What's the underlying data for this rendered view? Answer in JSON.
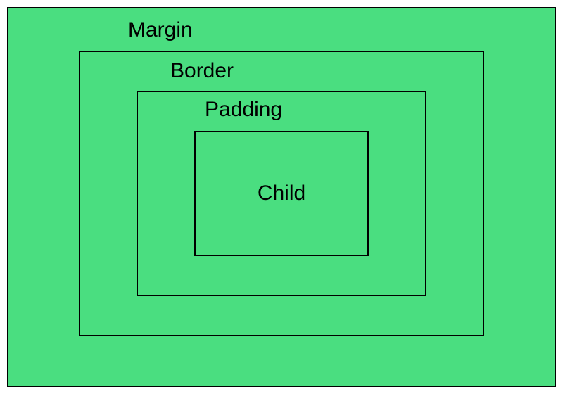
{
  "labels": {
    "margin": "Margin",
    "border": "Border",
    "padding": "Padding",
    "child": "Child"
  },
  "colors": {
    "background": "#4ade80",
    "border": "#000000"
  }
}
